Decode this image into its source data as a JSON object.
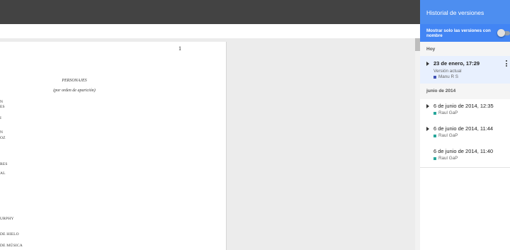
{
  "document": {
    "page_number": "1",
    "heading": "PERSONAJES",
    "subheading": "(por orden de aparición)",
    "cast_fragments": [
      "N",
      "ES",
      "I",
      "N",
      "OZ",
      "RES",
      "AL",
      "URPHY",
      "DE HIELO",
      "DE MÚSICA"
    ]
  },
  "panel": {
    "title": "Historial de versiones",
    "filter_label": "Mostrar solo las versiones con nombre",
    "sections": [
      {
        "label": "Hoy",
        "entries": [
          {
            "title": "23 de enero, 17:29",
            "subtitle": "Versión actual",
            "author": "Manu R S",
            "author_color": "#3f51b5"
          }
        ]
      },
      {
        "label": "junio de 2014",
        "entries": [
          {
            "title": "6 de junio de 2014, 12:35",
            "author": "Raul GaP",
            "author_color": "#26a69a"
          },
          {
            "title": "6 de junio de 2014, 11:44",
            "author": "Raul GaP",
            "author_color": "#26a69a"
          },
          {
            "title": "6 de junio de 2014, 11:40",
            "author": "Raul GaP",
            "author_color": "#26a69a"
          }
        ]
      }
    ]
  }
}
